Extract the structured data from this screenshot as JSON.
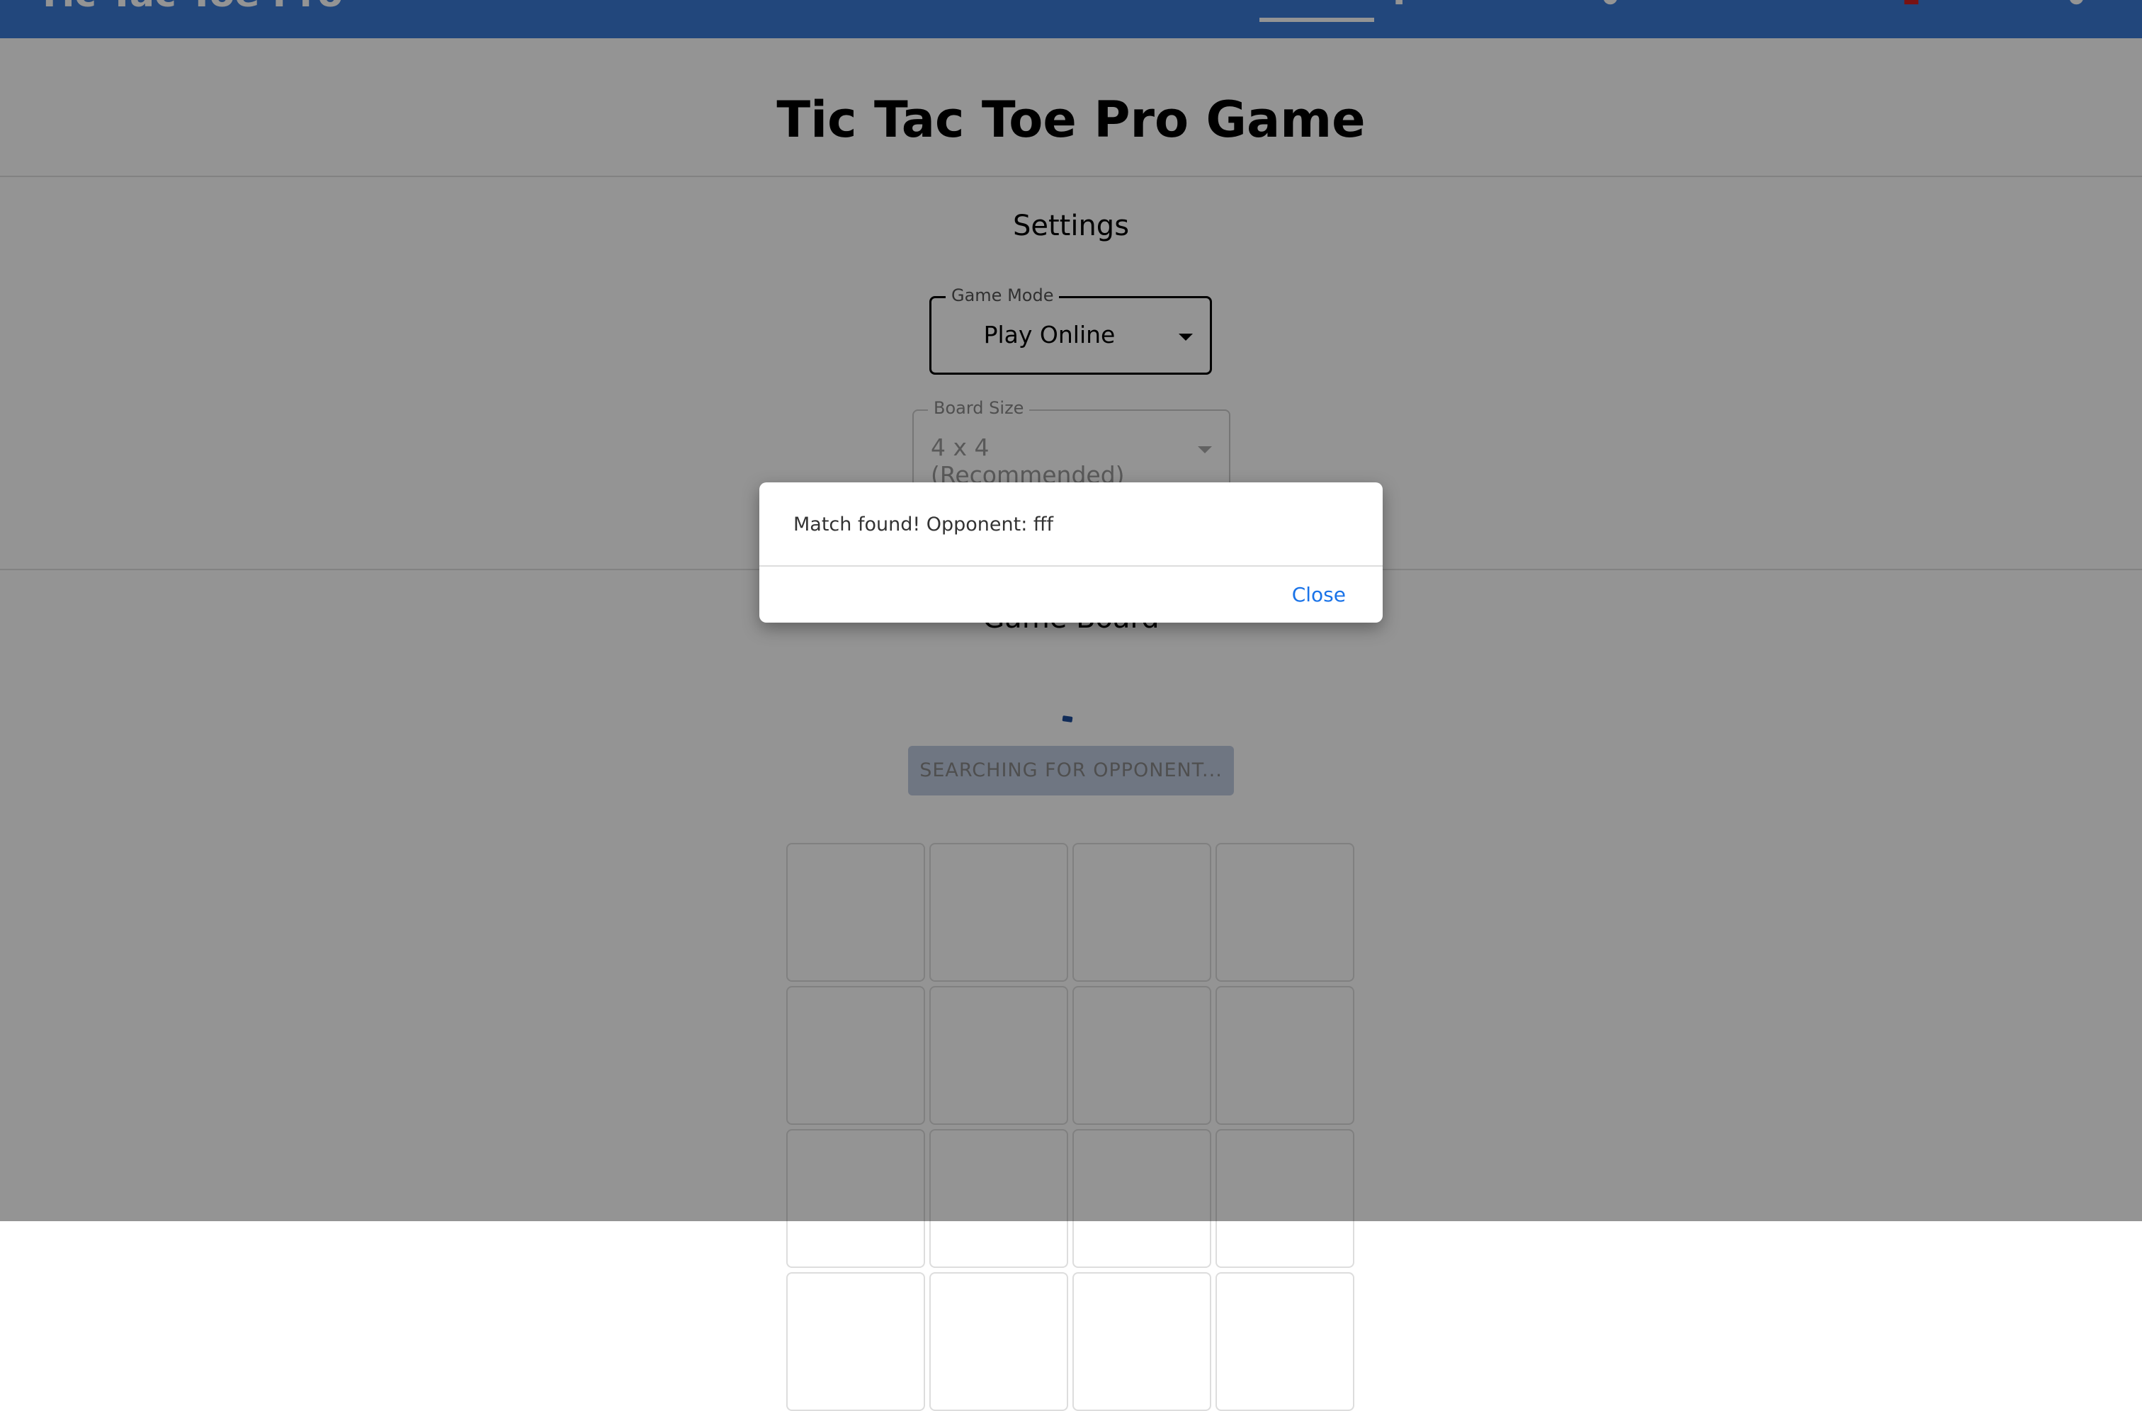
{
  "header": {
    "brand": "Tic Tac Toe Pro",
    "nav_icons": [
      "leaderboard-icon",
      "help-icon",
      "settings-icon",
      "logout-icon",
      "account-icon"
    ]
  },
  "page": {
    "title": "Tic Tac Toe Pro Game"
  },
  "settings": {
    "heading": "Settings",
    "game_mode": {
      "label": "Game Mode",
      "value": "Play Online"
    },
    "board_size": {
      "label": "Board Size",
      "value": "4 x 4 (Recommended)"
    }
  },
  "board": {
    "heading": "Game Board",
    "search_button": "SEARCHING FOR OPPONENT...",
    "size": 4
  },
  "dialog": {
    "message": "Match found! Opponent: fff",
    "close_label": "Close",
    "close_color": "#1a73e8"
  }
}
